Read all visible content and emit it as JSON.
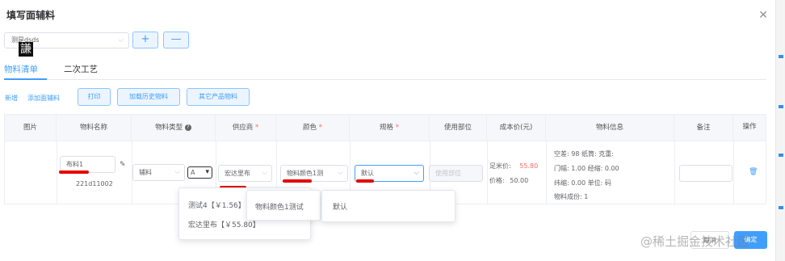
{
  "dialog": {
    "title": "填写面辅料",
    "close_icon": "close-icon"
  },
  "top_select": {
    "value": "测是dsds"
  },
  "top_buttons": {
    "add": "+",
    "remove": "—"
  },
  "tabs": [
    {
      "label": "物料清单",
      "active": true
    },
    {
      "label": "二次工艺",
      "active": false
    }
  ],
  "toolbar": {
    "add_link": "新增",
    "add_material_link": "添加面辅料",
    "print": "打印",
    "load_history": "加载历史物料",
    "other_product": "其它产品物料"
  },
  "table": {
    "headers": {
      "image": "图片",
      "name": "物料名称",
      "type": "物料类型",
      "supplier": "供应商",
      "color": "颜色",
      "spec": "规格",
      "usage_part": "使用部位",
      "cost": "成本价(元)",
      "info": "物料信息",
      "remark": "备注",
      "action": "操作"
    },
    "required_mark": "*",
    "row": {
      "thumb_glyph": "謙",
      "name": "布料1",
      "code": "221d11002",
      "type": "辅料",
      "unit_select": "A",
      "supplier": "宏达里布",
      "color": "物料颜色1测",
      "spec": "默认",
      "usage_placeholder": "使用部位",
      "price_label_1": "足米价:",
      "price_value_1": "55.80",
      "price_label_2": "价格:",
      "price_value_2": "50.00",
      "info_lines": [
        "空差:  98  纸筒:     克重:",
        "门幅:  1.00  经缩:  0.00",
        "纬缩:  0.00  单位:   码",
        "物料成份:  1"
      ],
      "remark": ""
    }
  },
  "dropdowns": {
    "supplier": [
      "测试4【￥1.56】",
      "宏达里布【￥55.80】"
    ],
    "color": [
      "物料颜色1测试"
    ],
    "spec": [
      "默认"
    ]
  },
  "footer": {
    "cancel": "取消",
    "confirm": "确定"
  },
  "watermark": "@稀土掘金技术社区",
  "colors": {
    "primary": "#409eff",
    "danger": "#f56c6c",
    "annotation": "#e60000"
  }
}
